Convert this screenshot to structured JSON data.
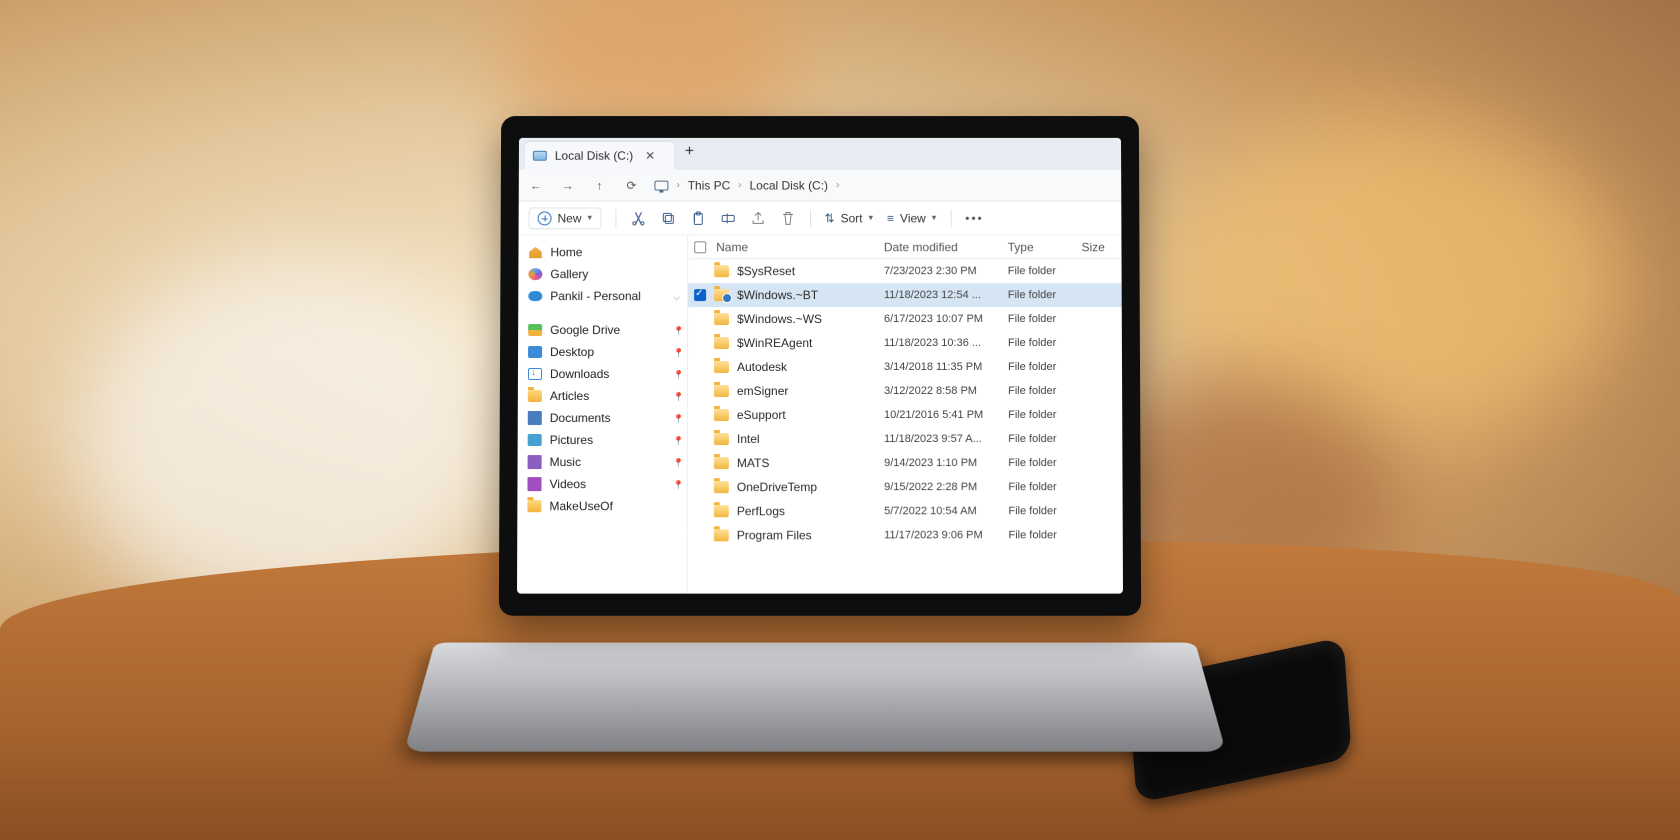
{
  "tab": {
    "title": "Local Disk (C:)"
  },
  "breadcrumbs": {
    "seg1": "This PC",
    "seg2": "Local Disk (C:)"
  },
  "toolbar": {
    "new_label": "New",
    "sort_label": "Sort",
    "view_label": "View"
  },
  "columns": {
    "name": "Name",
    "date": "Date modified",
    "type": "Type",
    "size": "Size"
  },
  "sidebar": {
    "home": "Home",
    "gallery": "Gallery",
    "personal": "Pankil - Personal",
    "items": [
      "Google Drive",
      "Desktop",
      "Downloads",
      "Articles",
      "Documents",
      "Pictures",
      "Music",
      "Videos",
      "MakeUseOf"
    ]
  },
  "files": [
    {
      "name": "$SysReset",
      "date": "7/23/2023 2:30 PM",
      "type": "File folder",
      "selected": false,
      "checkbox": false
    },
    {
      "name": "$Windows.~BT",
      "date": "11/18/2023 12:54 ...",
      "type": "File folder",
      "selected": true,
      "checkbox": true
    },
    {
      "name": "$Windows.~WS",
      "date": "6/17/2023 10:07 PM",
      "type": "File folder",
      "selected": false,
      "checkbox": false
    },
    {
      "name": "$WinREAgent",
      "date": "11/18/2023 10:36 ...",
      "type": "File folder",
      "selected": false,
      "checkbox": false
    },
    {
      "name": "Autodesk",
      "date": "3/14/2018 11:35 PM",
      "type": "File folder",
      "selected": false,
      "checkbox": false
    },
    {
      "name": "emSigner",
      "date": "3/12/2022 8:58 PM",
      "type": "File folder",
      "selected": false,
      "checkbox": false
    },
    {
      "name": "eSupport",
      "date": "10/21/2016 5:41 PM",
      "type": "File folder",
      "selected": false,
      "checkbox": false
    },
    {
      "name": "Intel",
      "date": "11/18/2023 9:57 A...",
      "type": "File folder",
      "selected": false,
      "checkbox": false
    },
    {
      "name": "MATS",
      "date": "9/14/2023 1:10 PM",
      "type": "File folder",
      "selected": false,
      "checkbox": false
    },
    {
      "name": "OneDriveTemp",
      "date": "9/15/2022 2:28 PM",
      "type": "File folder",
      "selected": false,
      "checkbox": false
    },
    {
      "name": "PerfLogs",
      "date": "5/7/2022 10:54 AM",
      "type": "File folder",
      "selected": false,
      "checkbox": false
    },
    {
      "name": "Program Files",
      "date": "11/17/2023 9:06 PM",
      "type": "File folder",
      "selected": false,
      "checkbox": false
    }
  ]
}
